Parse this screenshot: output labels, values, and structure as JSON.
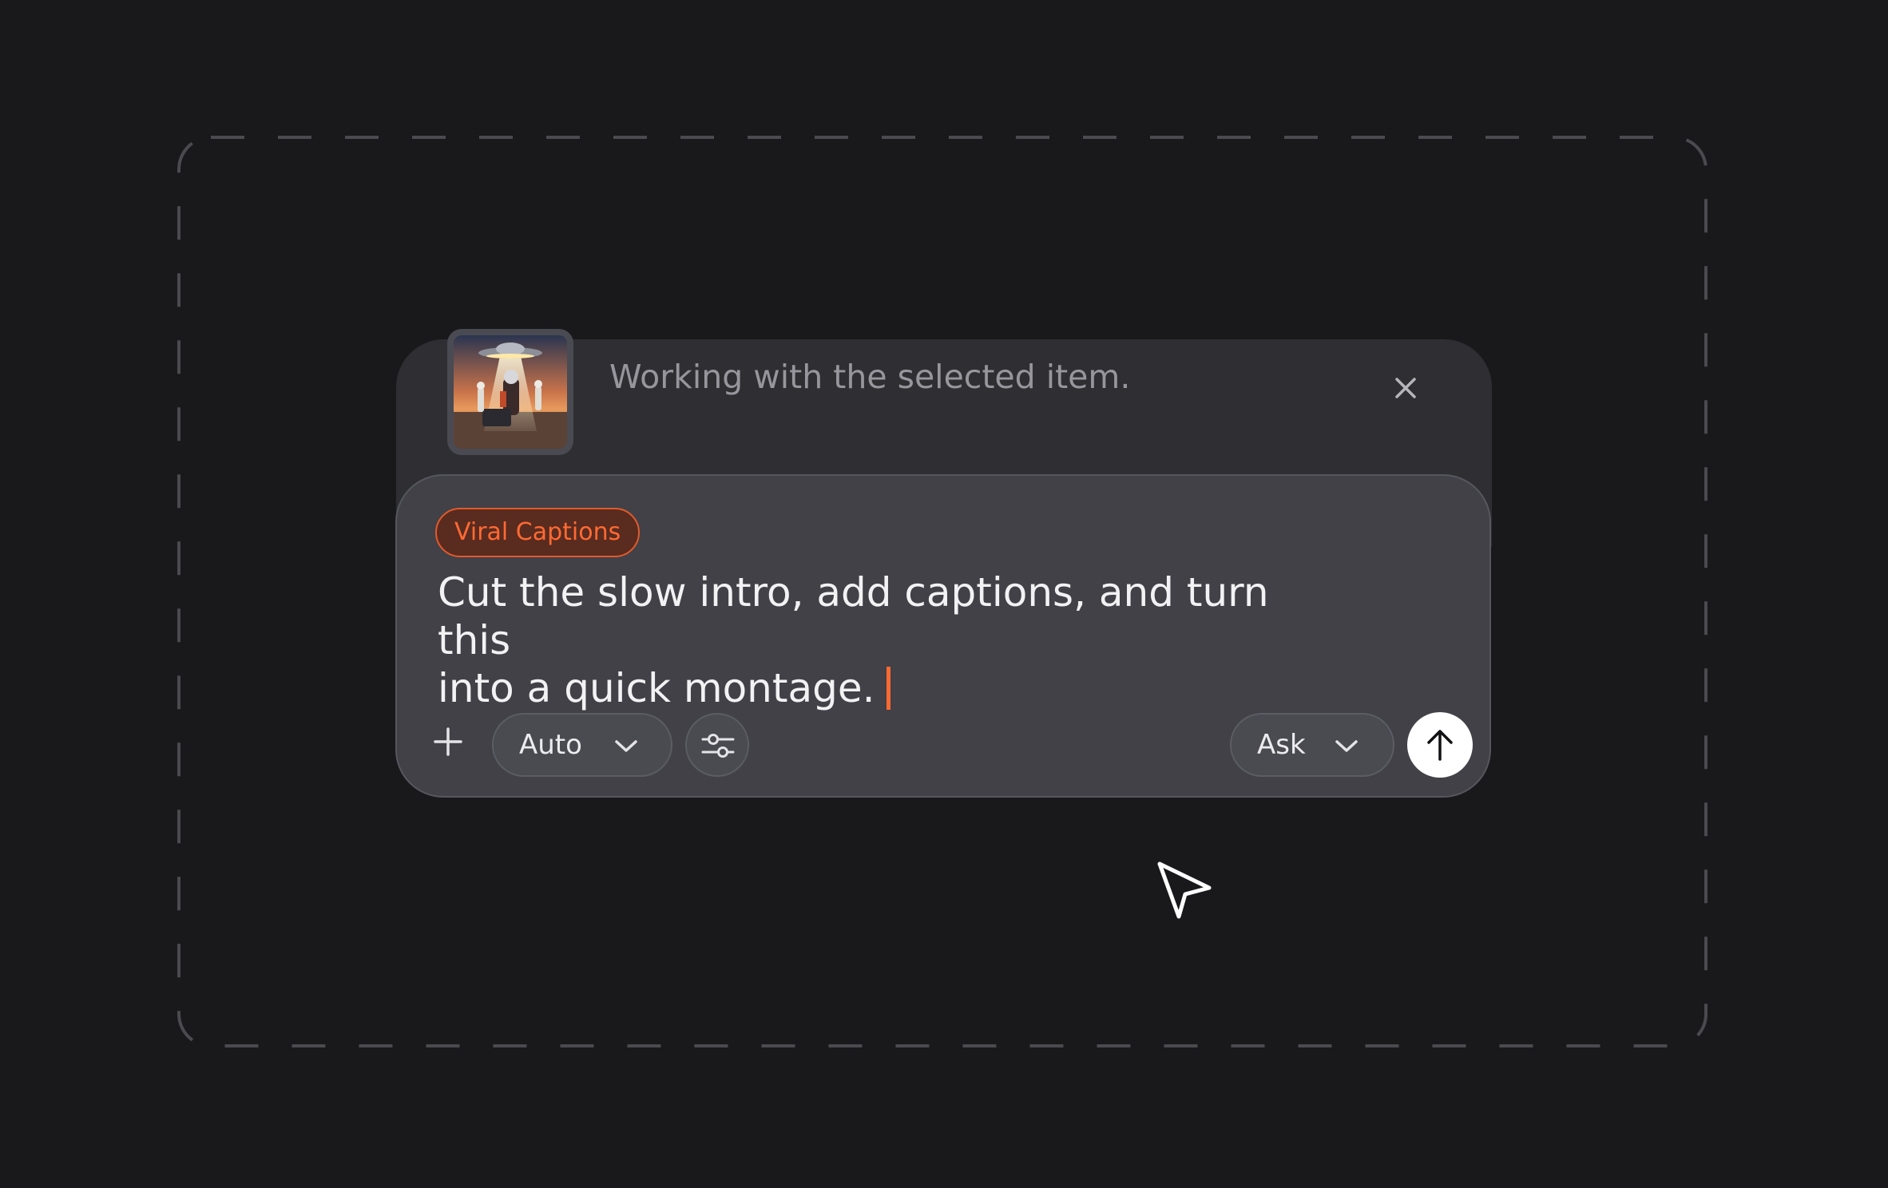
{
  "context": {
    "text": "Working with the selected item.",
    "thumbnail_icon": "ufo-desert-scene-thumbnail",
    "close_icon": "close-icon"
  },
  "composer": {
    "chip_label": "Viral Captions",
    "prompt_line1": "Cut the slow intro, add captions, and turn this",
    "prompt_line2": "into a quick montage.",
    "model_select": "Auto",
    "mode_select": "Ask",
    "add_icon": "plus-icon",
    "settings_icon": "sliders-icon",
    "send_icon": "arrow-up-icon"
  },
  "colors": {
    "background": "#19191b",
    "accent": "#ff6a33",
    "card": "#2e2e33",
    "composer": "#414147"
  }
}
